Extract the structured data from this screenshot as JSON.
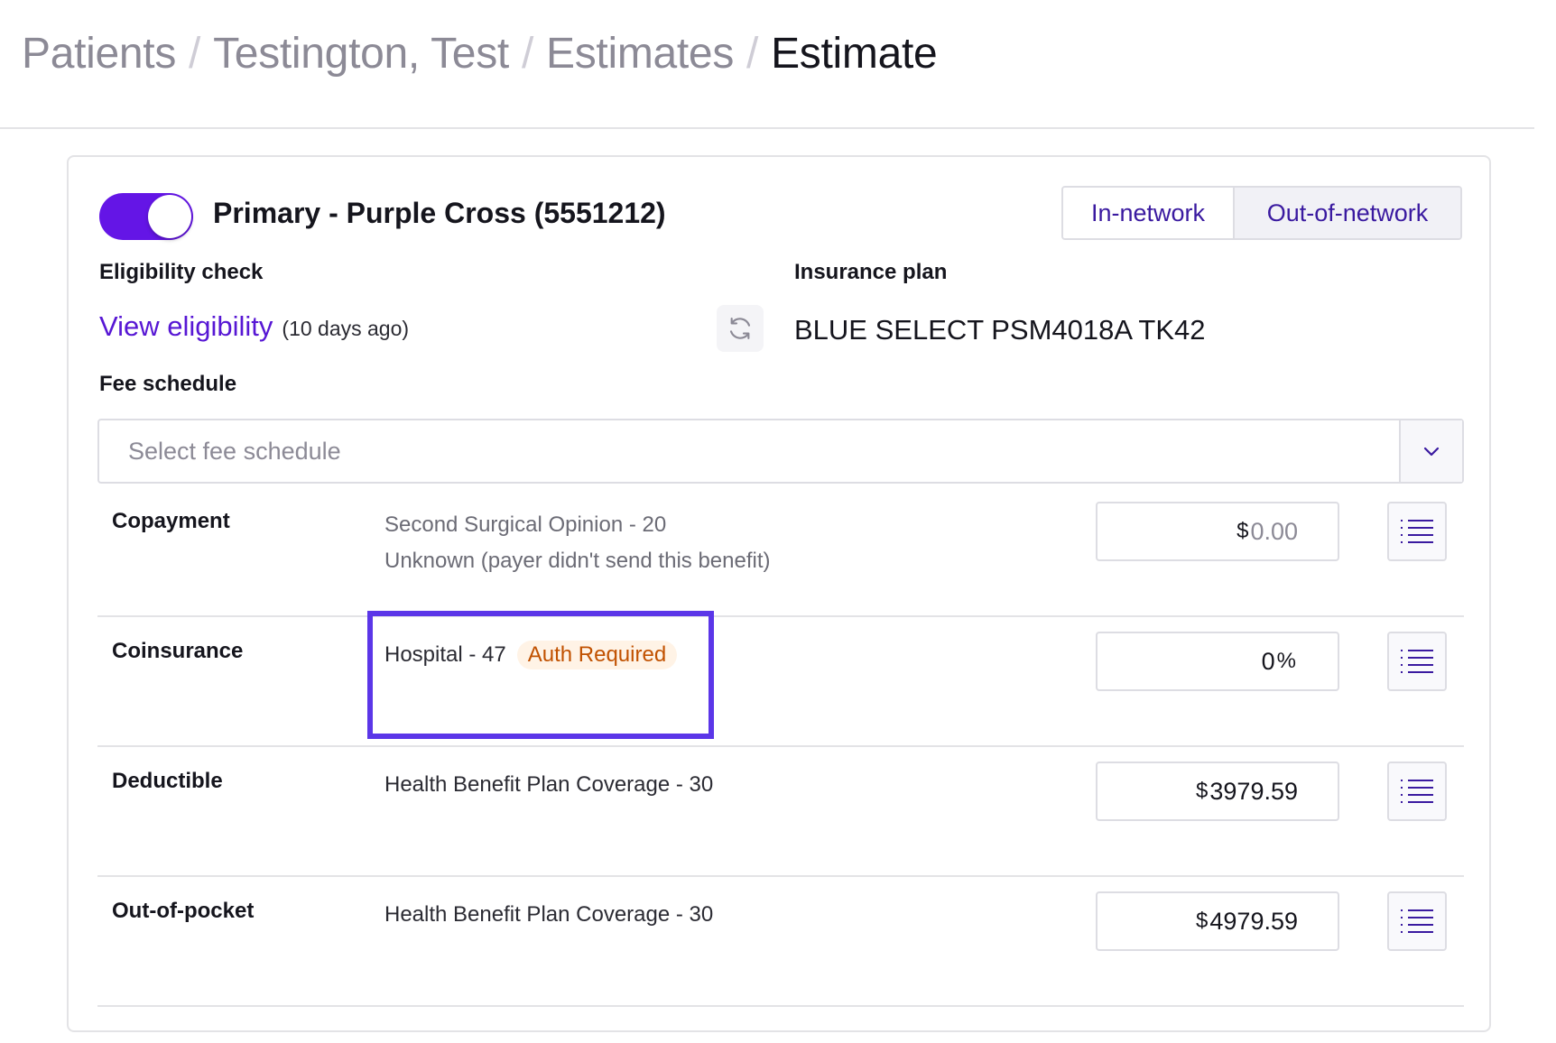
{
  "breadcrumb": {
    "items": [
      "Patients",
      "Testington, Test",
      "Estimates"
    ],
    "current": "Estimate",
    "separator": "/"
  },
  "policy": {
    "enabled": true,
    "title": "Primary - Purple Cross (5551212)",
    "network_options": [
      "In-network",
      "Out-of-network"
    ],
    "selected_network": "Out-of-network"
  },
  "eligibility": {
    "label": "Eligibility check",
    "link": "View eligibility",
    "ago": "(10 days ago)"
  },
  "insurance": {
    "label": "Insurance plan",
    "value": "BLUE SELECT PSM4018A TK42"
  },
  "fee_schedule": {
    "label": "Fee schedule",
    "placeholder": "Select fee schedule"
  },
  "benefits": {
    "copayment": {
      "label": "Copayment",
      "line1": "Second Surgical Opinion - 20",
      "line2": "Unknown (payer didn't send this benefit)",
      "currency": "$",
      "value": "0.00"
    },
    "coinsurance": {
      "label": "Coinsurance",
      "desc": "Hospital - 47",
      "badge": "Auth Required",
      "value": "0",
      "unit": "%"
    },
    "deductible": {
      "label": "Deductible",
      "desc": "Health Benefit Plan Coverage - 30",
      "currency": "$",
      "value": "3979.59"
    },
    "out_of_pocket": {
      "label": "Out-of-pocket",
      "desc": "Health Benefit Plan Coverage - 30",
      "currency": "$",
      "value": "4979.59"
    }
  },
  "colors": {
    "accent": "#6415e6",
    "link": "#5717d4",
    "badge_bg": "#fff3e6",
    "badge_text": "#c15100",
    "highlight": "#5b36e8"
  },
  "icons": {
    "refresh": "refresh-icon",
    "dropdown": "chevron-down-icon",
    "menu": "list-icon"
  }
}
